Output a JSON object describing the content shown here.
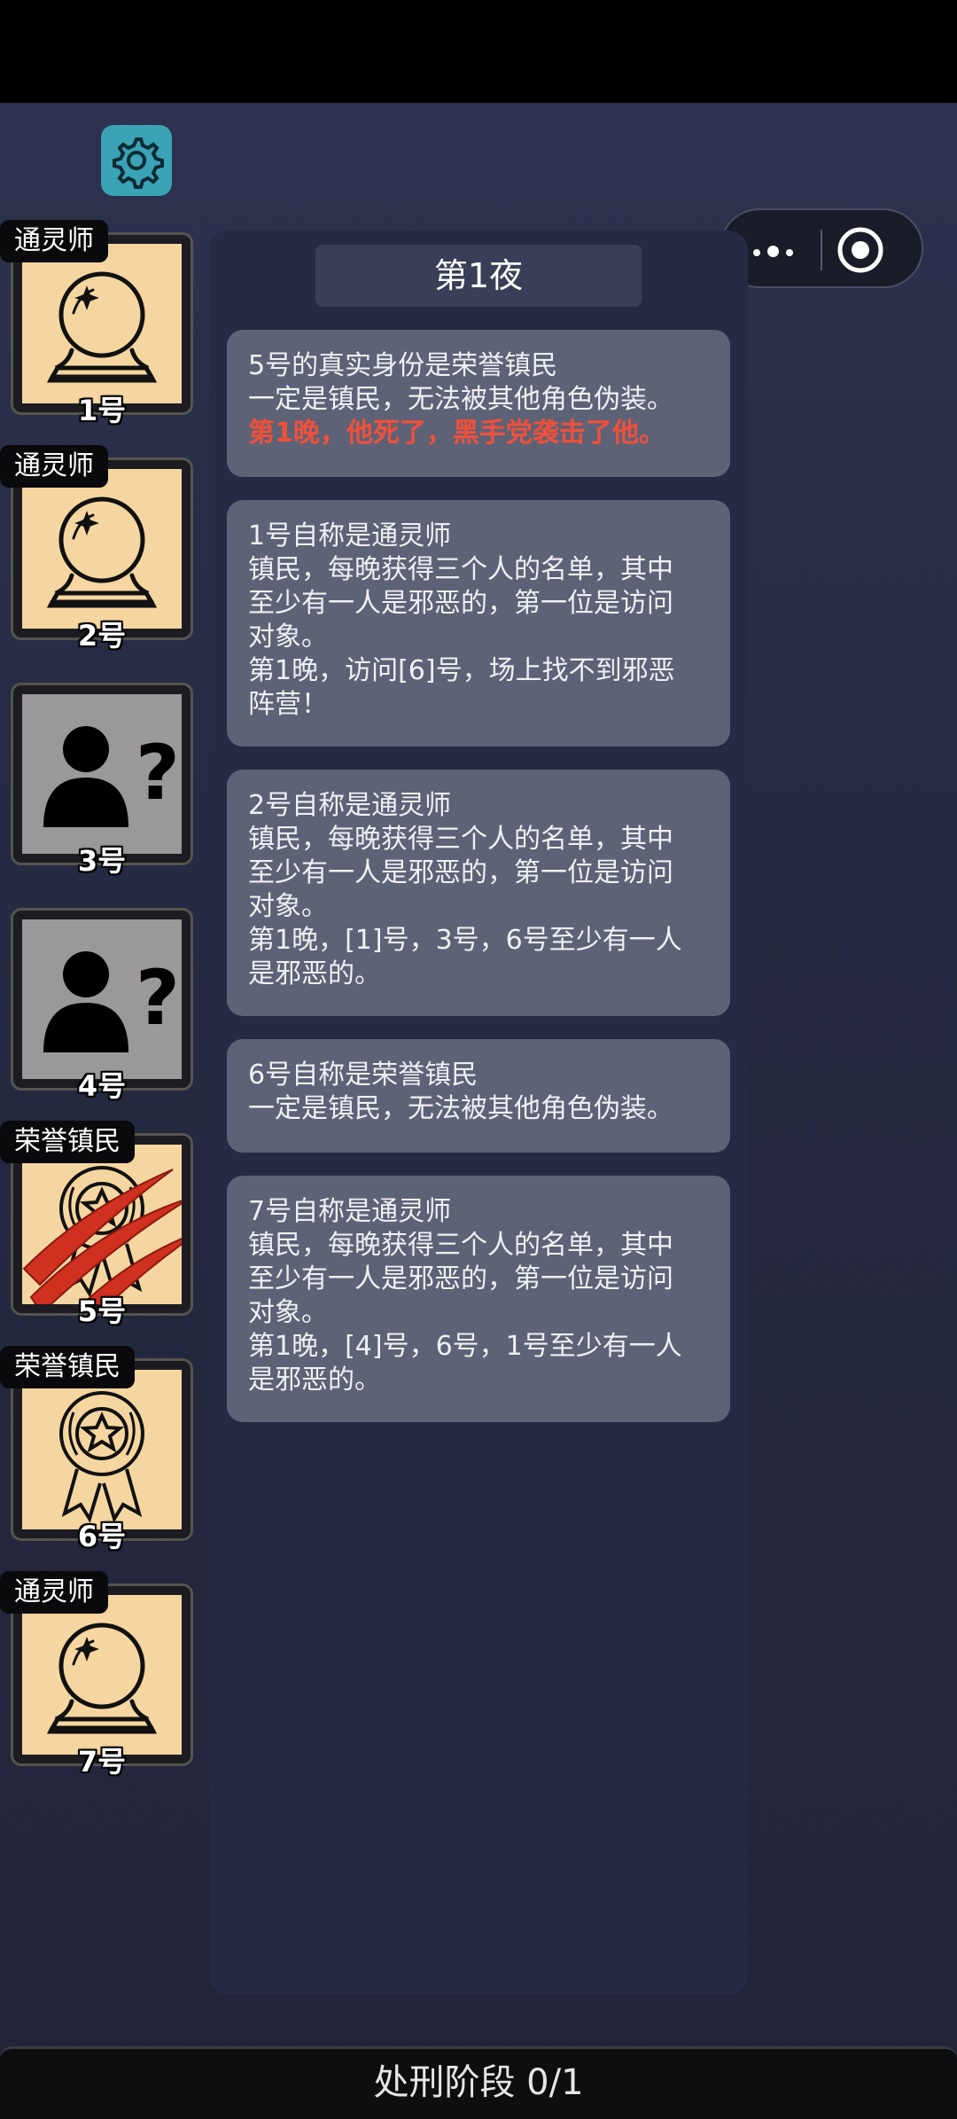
{
  "night_header": {
    "label": "第1夜"
  },
  "players": [
    {
      "role": "通灵师",
      "seat": "1号",
      "icon": "crystal-ball-icon"
    },
    {
      "role": "通灵师",
      "seat": "2号",
      "icon": "crystal-ball-icon"
    },
    {
      "role": "",
      "seat": "3号",
      "icon": "unknown-person-icon"
    },
    {
      "role": "",
      "seat": "4号",
      "icon": "unknown-person-icon"
    },
    {
      "role": "荣誉镇民",
      "seat": "5号",
      "icon": "medal-icon",
      "status": "dead"
    },
    {
      "role": "荣誉镇民",
      "seat": "6号",
      "icon": "medal-icon"
    },
    {
      "role": "通灵师",
      "seat": "7号",
      "icon": "crystal-ball-icon"
    }
  ],
  "messages": [
    {
      "lines": [
        "5号的真实身份是荣誉镇民",
        "一定是镇民，无法被其他角色伪装。"
      ],
      "highlight": "第1晚，他死了，黑手党袭击了他。"
    },
    {
      "lines": [
        "1号自称是通灵师",
        "镇民，每晚获得三个人的名单，其中",
        "至少有一人是邪恶的，第一位是访问",
        "对象。",
        "第1晚，访问[6]号，场上找不到邪恶",
        "阵营！"
      ]
    },
    {
      "lines": [
        "2号自称是通灵师",
        "镇民，每晚获得三个人的名单，其中",
        "至少有一人是邪恶的，第一位是访问",
        "对象。",
        "第1晚，[1]号，3号，6号至少有一人",
        "是邪恶的。"
      ]
    },
    {
      "lines": [
        "6号自称是荣誉镇民",
        "一定是镇民，无法被其他角色伪装。"
      ]
    },
    {
      "lines": [
        "7号自称是通灵师",
        "镇民，每晚获得三个人的名单，其中",
        "至少有一人是邪恶的，第一位是访问",
        "对象。",
        "第1晚，[4]号，6号，1号至少有一人",
        "是邪恶的。"
      ]
    }
  ],
  "bottom_bar": {
    "label": "处刑阶段 0/1"
  },
  "colors": {
    "highlight": "#f0503a",
    "card_bg": "#f6d6a0",
    "unknown_bg": "#9a9898",
    "gear_bg": "#3aa3b5"
  }
}
